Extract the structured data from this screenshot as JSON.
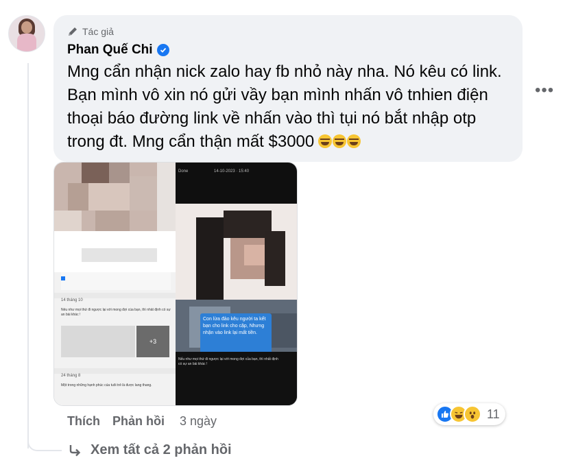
{
  "comment": {
    "badge": "Tác giả",
    "author": "Phan Quế Chi",
    "text": "Mng cẩn nhận nick zalo hay fb nhỏ này nha. Nó kêu có link. Bạn mình vô xin nó gửi vầy bạn mình nhấn vô tnhien điện thoại báo đường link về nhấn vào thì tụi nó bắt nhập otp trong đt. Mng cẩn thận mất $3000",
    "emojis": [
      "laughing-emoji",
      "laughing-emoji",
      "laughing-emoji"
    ],
    "more_label": "•••"
  },
  "attachment": {
    "left_header": "",
    "right_status": "Done",
    "right_time": "14-10-2023 · 15:40",
    "left_date_1": "14 tháng 10",
    "left_post_text": "Nếu như mọi thứ đi ngược lại với mong đợi của bạn, thì nhất định có sự an bài khác !",
    "left_more": "+3",
    "left_date_2": "24 tháng 8",
    "left_post_text_2": "Một trong những hạnh phúc của tuổi trẻ là được lang thang.",
    "blue_message": "Con lừa đảo kêu người ta kết bạn cho link cho cặp, Nhưng nhận vào link lại mất tiền.",
    "right_caption": "Nếu như mọi thứ đi ngược lại với mong đợi của bạn, thì nhất định có sự an bài khác !"
  },
  "actions": {
    "like": "Thích",
    "reply": "Phản hồi",
    "time": "3 ngày"
  },
  "reactions": {
    "types": [
      "like-icon",
      "haha-icon",
      "wow-icon"
    ],
    "count": "11"
  },
  "replies": {
    "label": "Xem tất cả 2 phản hồi"
  },
  "colors": {
    "bubble_bg": "#f0f2f5",
    "secondary_text": "#65676b",
    "accent_blue": "#1877f2"
  }
}
